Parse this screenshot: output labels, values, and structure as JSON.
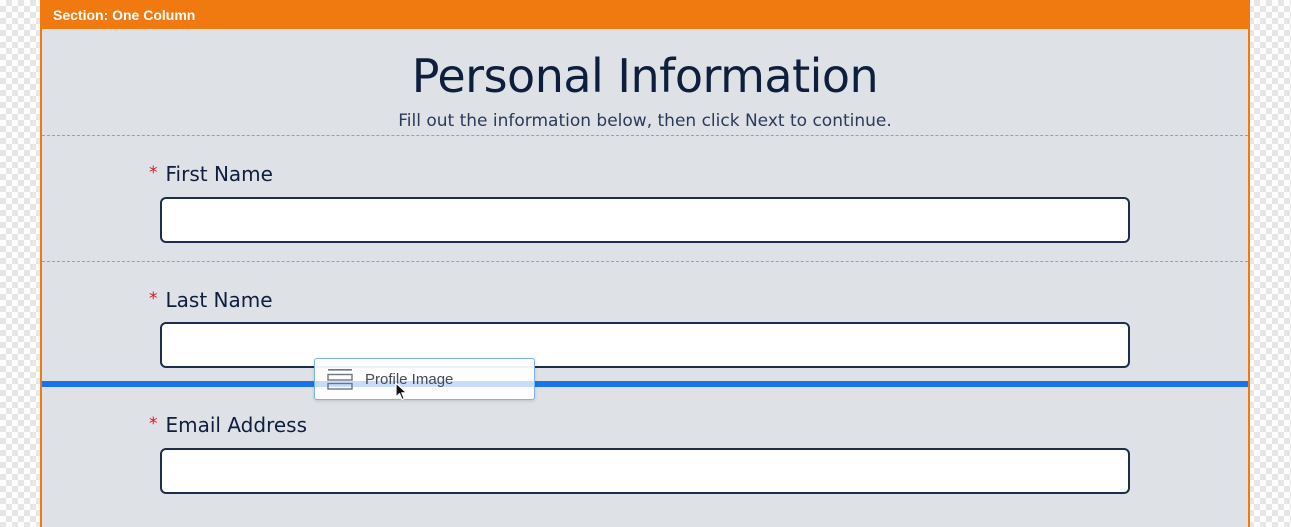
{
  "section": {
    "header_label": "Section: One Column"
  },
  "form": {
    "title": "Personal Information",
    "subtitle": "Fill out the information below, then click Next to continue.",
    "fields": [
      {
        "label": "First Name",
        "required_mark": "*",
        "value": ""
      },
      {
        "label": "Last Name",
        "required_mark": "*",
        "value": ""
      },
      {
        "label": "Email Address",
        "required_mark": "*",
        "value": ""
      }
    ]
  },
  "drag": {
    "ghost_label": "Profile Image",
    "ghost_icon": "form-element-icon",
    "cursor_icon": "arrow-cursor-icon"
  },
  "colors": {
    "section_accent": "#f07a10",
    "canvas_bg": "#dee2e7",
    "text_primary": "#0e1e3d",
    "required": "#d8141b",
    "drop_indicator": "#1a73e8"
  }
}
